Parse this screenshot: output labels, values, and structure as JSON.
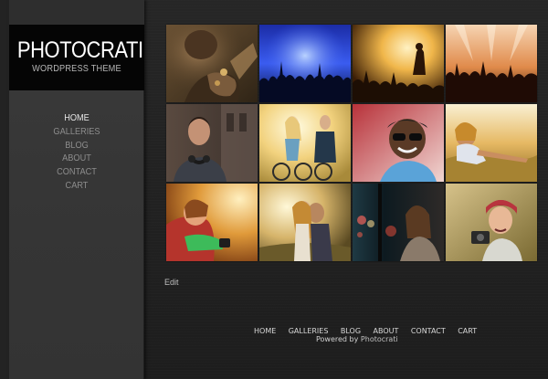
{
  "site": {
    "title": "PHOTOCRATI",
    "subtitle": "WORDPRESS THEME"
  },
  "sidebar": {
    "nav": [
      {
        "label": "HOME",
        "active": true
      },
      {
        "label": "GALLERIES",
        "active": false
      },
      {
        "label": "BLOG",
        "active": false
      },
      {
        "label": "ABOUT",
        "active": false
      },
      {
        "label": "CONTACT",
        "active": false
      },
      {
        "label": "CART",
        "active": false
      }
    ]
  },
  "gallery": {
    "thumbnails": [
      {
        "subject": "hands-with-keys"
      },
      {
        "subject": "concert-crowd-blue"
      },
      {
        "subject": "concert-singer-golden"
      },
      {
        "subject": "concert-crowd-lights"
      },
      {
        "subject": "man-with-headphones"
      },
      {
        "subject": "couple-with-bicycles"
      },
      {
        "subject": "man-with-sunglasses"
      },
      {
        "subject": "woman-in-field"
      },
      {
        "subject": "hugging-in-sunset"
      },
      {
        "subject": "couple-kissing"
      },
      {
        "subject": "woman-city-lights"
      },
      {
        "subject": "woman-with-camera"
      }
    ]
  },
  "content": {
    "edit_label": "Edit"
  },
  "footer": {
    "nav": [
      "HOME",
      "GALLERIES",
      "BLOG",
      "ABOUT",
      "CONTACT",
      "CART"
    ],
    "powered_prefix": "Powered by",
    "powered_link": "Photocrati"
  }
}
